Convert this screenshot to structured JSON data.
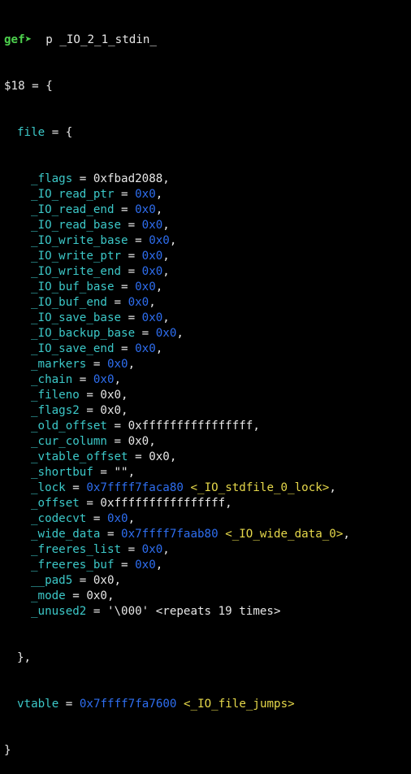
{
  "colors": {
    "background": "#000000",
    "text": "#e6e6e6",
    "prompt": "#4dd04d",
    "field": "#3cc8c8",
    "address": "#2e6ef0",
    "symbol": "#e6d84a"
  },
  "prompt": {
    "label": "gef➤",
    "command": "  p _IO_2_1_stdin_"
  },
  "header": {
    "var": "$18 = {"
  },
  "file_open": {
    "name": "file",
    "suffix": " = {"
  },
  "fields": [
    {
      "name": "_flags",
      "value": "0xfbad2088",
      "kind": "plain",
      "suffix": ","
    },
    {
      "name": "_IO_read_ptr",
      "value": "0x0",
      "kind": "addr",
      "suffix": ","
    },
    {
      "name": "_IO_read_end",
      "value": "0x0",
      "kind": "addr",
      "suffix": ","
    },
    {
      "name": "_IO_read_base",
      "value": "0x0",
      "kind": "addr",
      "suffix": ","
    },
    {
      "name": "_IO_write_base",
      "value": "0x0",
      "kind": "addr",
      "suffix": ","
    },
    {
      "name": "_IO_write_ptr",
      "value": "0x0",
      "kind": "addr",
      "suffix": ","
    },
    {
      "name": "_IO_write_end",
      "value": "0x0",
      "kind": "addr",
      "suffix": ","
    },
    {
      "name": "_IO_buf_base",
      "value": "0x0",
      "kind": "addr",
      "suffix": ","
    },
    {
      "name": "_IO_buf_end",
      "value": "0x0",
      "kind": "addr",
      "suffix": ","
    },
    {
      "name": "_IO_save_base",
      "value": "0x0",
      "kind": "addr",
      "suffix": ","
    },
    {
      "name": "_IO_backup_base",
      "value": "0x0",
      "kind": "addr",
      "suffix": ","
    },
    {
      "name": "_IO_save_end",
      "value": "0x0",
      "kind": "addr",
      "suffix": ","
    },
    {
      "name": "_markers",
      "value": "0x0",
      "kind": "addr",
      "suffix": ","
    },
    {
      "name": "_chain",
      "value": "0x0",
      "kind": "addr",
      "suffix": ","
    },
    {
      "name": "_fileno",
      "value": "0x0",
      "kind": "plain",
      "suffix": ","
    },
    {
      "name": "_flags2",
      "value": "0x0",
      "kind": "plain",
      "suffix": ","
    },
    {
      "name": "_old_offset",
      "value": "0xffffffffffffffff",
      "kind": "plain",
      "suffix": ","
    },
    {
      "name": "_cur_column",
      "value": "0x0",
      "kind": "plain",
      "suffix": ","
    },
    {
      "name": "_vtable_offset",
      "value": "0x0",
      "kind": "plain",
      "suffix": ","
    },
    {
      "name": "_shortbuf",
      "value": "\"\"",
      "kind": "plain",
      "suffix": ","
    },
    {
      "name": "_lock",
      "value": "0x7ffff7faca80",
      "kind": "addr",
      "symbol": "<_IO_stdfile_0_lock>",
      "suffix": ","
    },
    {
      "name": "_offset",
      "value": "0xffffffffffffffff",
      "kind": "plain",
      "suffix": ","
    },
    {
      "name": "_codecvt",
      "value": "0x0",
      "kind": "addr",
      "suffix": ","
    },
    {
      "name": "_wide_data",
      "value": "0x7ffff7faab80",
      "kind": "addr",
      "symbol": "<_IO_wide_data_0>",
      "suffix": ","
    },
    {
      "name": "_freeres_list",
      "value": "0x0",
      "kind": "addr",
      "suffix": ","
    },
    {
      "name": "_freeres_buf",
      "value": "0x0",
      "kind": "addr",
      "suffix": ","
    },
    {
      "name": "__pad5",
      "value": "0x0",
      "kind": "plain",
      "suffix": ","
    },
    {
      "name": "_mode",
      "value": "0x0",
      "kind": "plain",
      "suffix": ","
    },
    {
      "name": "_unused2",
      "value": "'\\000' <repeats 19 times>",
      "kind": "plain",
      "suffix": ""
    }
  ],
  "file_close": "},",
  "vtable": {
    "name": "vtable",
    "value": "0x7ffff7fa7600",
    "symbol": "<_IO_file_jumps>"
  },
  "footer": {
    "close": "}"
  }
}
